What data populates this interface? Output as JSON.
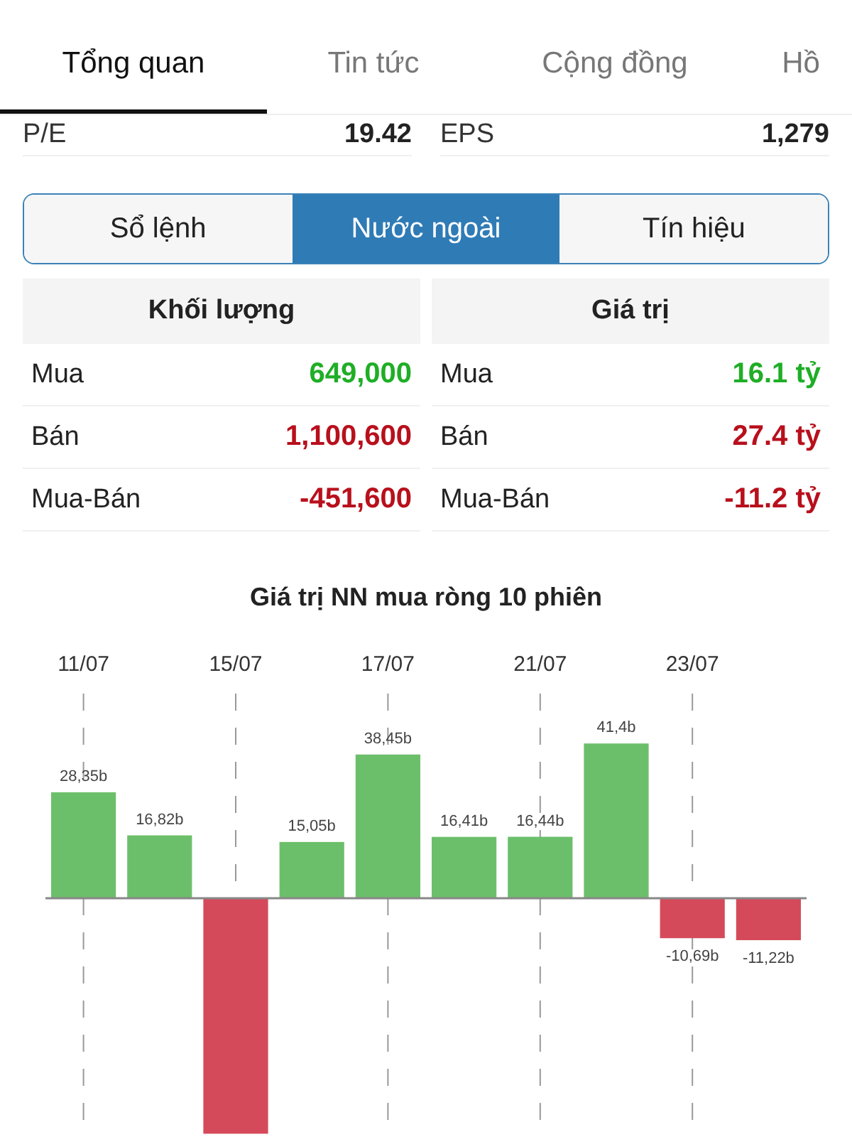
{
  "tabs": [
    {
      "label": "Tổng quan",
      "selected": true
    },
    {
      "label": "Tin tức",
      "selected": false
    },
    {
      "label": "Cộng đồng",
      "selected": false
    },
    {
      "label": "Hồ",
      "selected": false
    }
  ],
  "stats": [
    {
      "label": "P/E",
      "value": "19.42"
    },
    {
      "label": "EPS",
      "value": "1,279"
    }
  ],
  "segments": [
    {
      "label": "Sổ lệnh",
      "selected": false
    },
    {
      "label": "Nước ngoài",
      "selected": true
    },
    {
      "label": "Tín hiệu",
      "selected": false
    }
  ],
  "tables": [
    {
      "header": "Khối lượng",
      "rows": [
        {
          "label": "Mua",
          "value": "649,000",
          "color": "#1fae26"
        },
        {
          "label": "Bán",
          "value": "1,100,600",
          "color": "#b8101c"
        },
        {
          "label": "Mua-Bán",
          "value": "-451,600",
          "color": "#b8101c"
        }
      ]
    },
    {
      "header": "Giá trị",
      "rows": [
        {
          "label": "Mua",
          "value": "16.1 tỷ",
          "color": "#1fae26"
        },
        {
          "label": "Bán",
          "value": "27.4 tỷ",
          "color": "#b8101c"
        },
        {
          "label": "Mua-Bán",
          "value": "-11.2 tỷ",
          "color": "#b8101c"
        }
      ]
    }
  ],
  "chart": {
    "chart_data": {
      "type": "bar",
      "title": "Giá trị NN mua ròng 10 phiên",
      "grid": true,
      "categories": [
        "11/07",
        null,
        "15/07",
        null,
        "17/07",
        null,
        "21/07",
        null,
        "23/07",
        null
      ],
      "values": [
        28.35,
        16.82,
        -63,
        15.05,
        38.45,
        16.41,
        16.44,
        41.4,
        -10.69,
        -11.22
      ],
      "value_labels": [
        "28,35b",
        "16,82b",
        null,
        "15,05b",
        "38,45b",
        "16,41b",
        "16,44b",
        "41,4b",
        "-10,69b",
        "-11,22b"
      ]
    }
  }
}
